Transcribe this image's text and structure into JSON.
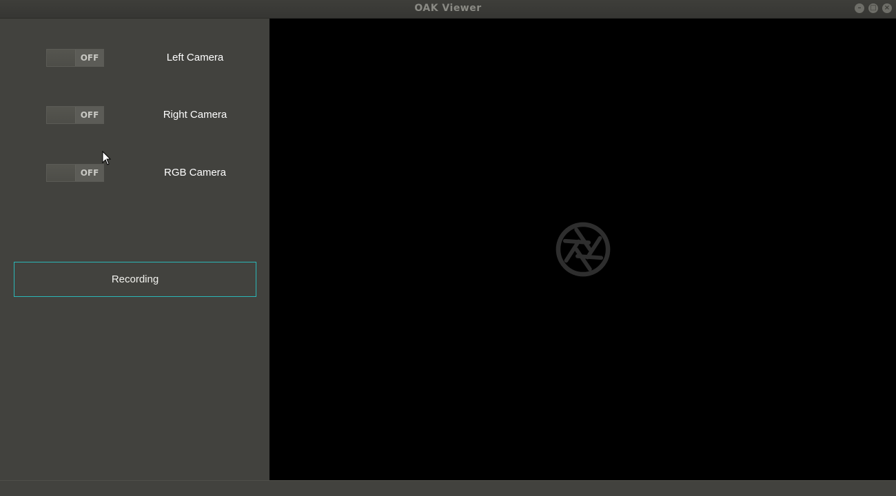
{
  "window": {
    "title": "OAK Viewer",
    "controls": [
      "minimize",
      "maximize",
      "close"
    ]
  },
  "cameras": [
    {
      "label": "Left Camera",
      "toggle_state": "OFF"
    },
    {
      "label": "Right Camera",
      "toggle_state": "OFF"
    },
    {
      "label": "RGB Camera",
      "toggle_state": "OFF"
    }
  ],
  "recording": {
    "label": "Recording",
    "accent": "#2bb8b8"
  },
  "viewport": {
    "placeholder_icon": "camera-aperture-icon",
    "background": "#000000"
  },
  "colors": {
    "panel": "#42423e",
    "text": "#ffffff"
  }
}
